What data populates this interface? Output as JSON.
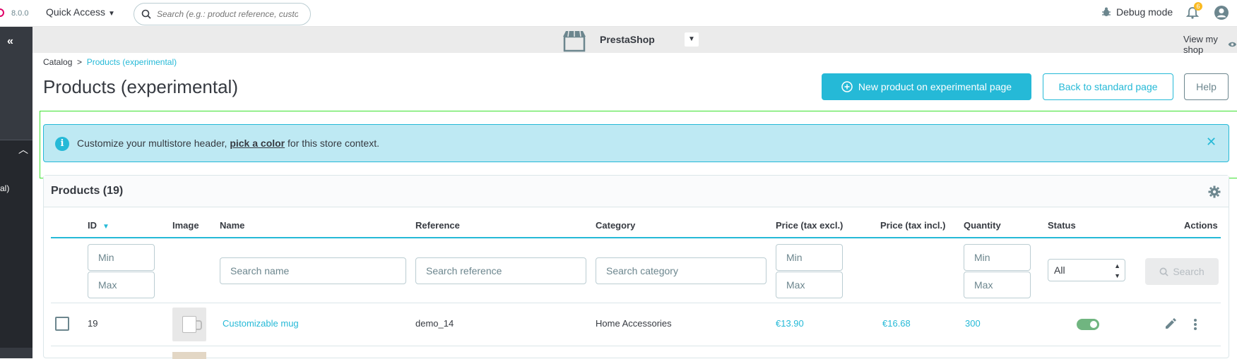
{
  "header": {
    "version": "8.0.0",
    "quick_access": "Quick Access",
    "search_placeholder": "Search (e.g.: product reference, custon",
    "debug_mode": "Debug mode",
    "notifications_count": "6"
  },
  "sidebar": {
    "partial_label": "al)"
  },
  "shop": {
    "name": "PrestaShop",
    "view_shop": "View my shop"
  },
  "breadcrumb": {
    "parent": "Catalog",
    "separator": ">",
    "current": "Products (experimental)"
  },
  "page": {
    "title": "Products (experimental)",
    "new_product_btn": "New product on experimental page",
    "back_btn": "Back to standard page",
    "help_btn": "Help"
  },
  "alert": {
    "text_before": "Customize your multistore header, ",
    "link": "pick a color",
    "text_after": " for this store context."
  },
  "grid": {
    "title": "Products (19)",
    "columns": {
      "id": "ID",
      "image": "Image",
      "name": "Name",
      "reference": "Reference",
      "category": "Category",
      "price_excl": "Price (tax excl.)",
      "price_incl": "Price (tax incl.)",
      "quantity": "Quantity",
      "status": "Status",
      "actions": "Actions"
    },
    "filters": {
      "min": "Min",
      "max": "Max",
      "search_name": "Search name",
      "search_reference": "Search reference",
      "search_category": "Search category",
      "status_selected": "All",
      "search_btn": "Search"
    },
    "rows": [
      {
        "id": "19",
        "name": "Customizable mug",
        "reference": "demo_14",
        "category": "Home Accessories",
        "price_excl": "€13.90",
        "price_incl": "€16.68",
        "quantity": "300",
        "status_enabled": true
      }
    ]
  },
  "colors": {
    "accent": "#25b9d7",
    "sidebar": "#363a41",
    "alert_bg": "#bee9f3",
    "toggle_on": "#70b580"
  }
}
